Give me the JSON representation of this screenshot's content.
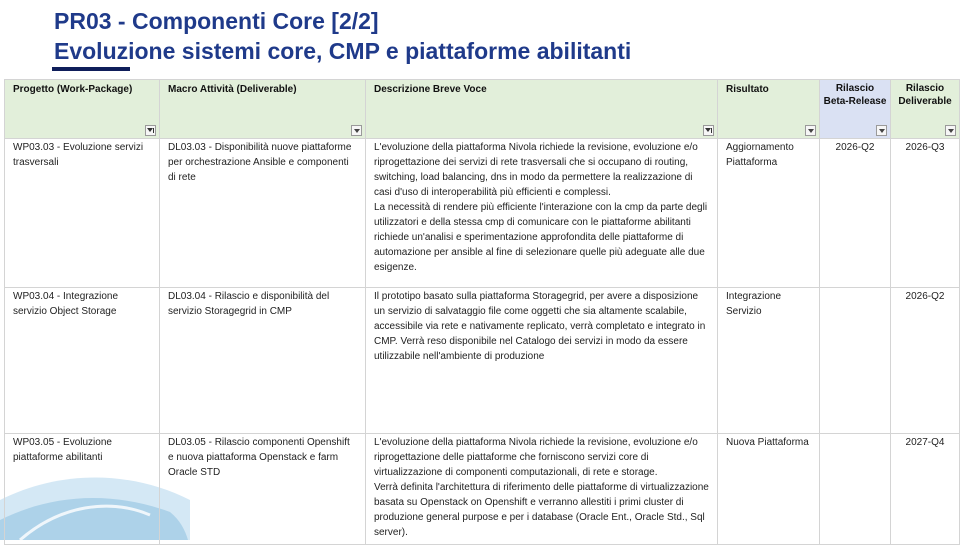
{
  "slide": {
    "title_line1": "PR03 - Componenti Core [2/2]",
    "title_line2": "Evoluzione sistemi core, CMP e piattaforme abilitanti"
  },
  "table": {
    "headers": [
      {
        "label": "Progetto (Work-Package)",
        "color": "#e2efda",
        "filter": "active"
      },
      {
        "label": "Macro Attività (Deliverable)",
        "color": "#e2efda",
        "filter": "dropdown"
      },
      {
        "label": "Descrizione Breve Voce",
        "color": "#e2efda",
        "filter": "active"
      },
      {
        "label": "Risultato",
        "color": "#e2efda",
        "filter": "dropdown"
      },
      {
        "label": "Rilascio Beta-Release",
        "color": "#dae1f3",
        "filter": "dropdown"
      },
      {
        "label": "Rilascio Deliverable",
        "color": "#dae1f3",
        "filter": "dropdown"
      }
    ],
    "rows": [
      {
        "progetto": "WP03.03 - Evoluzione servizi trasversali",
        "macro": "DL03.03 - Disponibilità nuove piattaforme per orchestrazione Ansible e componenti di rete",
        "descrizione_1": "L'evoluzione della piattaforma Nivola richiede la revisione, evoluzione e/o riprogettazione dei servizi di rete trasversali che si occupano di routing, switching, load balancing, dns in modo da permettere la realizzazione di casi d'uso di interoperabilità più efficienti e complessi.",
        "descrizione_2": "La necessità di rendere più efficiente l'interazione con la cmp da parte degli utilizzatori e della stessa cmp di comunicare con le piattaforme abilitanti richiede un'analisi e sperimentazione approfondita delle piattaforme di automazione per ansible al fine di selezionare quelle più adeguate alle due esigenze.",
        "risultato": "Aggiornamento Piattaforma",
        "beta": "2026-Q2",
        "deliverable": "2026-Q3"
      },
      {
        "progetto": "WP03.04 - Integrazione servizio Object Storage",
        "macro": "DL03.04 - Rilascio e disponibilità del servizio Storagegrid in CMP",
        "descrizione_1": "Il prototipo basato sulla piattaforma Storagegrid, per avere a disposizione un servizio di salvataggio file come oggetti che sia altamente scalabile, accessibile via rete e nativamente replicato, verrà completato e integrato in CMP. Verrà reso disponibile nel Catalogo dei servizi in modo da essere utilizzabile nell'ambiente di produzione",
        "descrizione_2": "",
        "risultato": "Integrazione Servizio",
        "beta": "",
        "deliverable": "2026-Q2"
      },
      {
        "progetto": "WP03.05 - Evoluzione piattaforme abilitanti",
        "macro": "DL03.05 - Rilascio componenti Openshift e nuova piattaforma Openstack e farm Oracle STD",
        "descrizione_1": "L'evoluzione della piattaforma Nivola richiede la revisione, evoluzione e/o riprogettazione delle piattaforme che forniscono servizi core di virtualizzazione di componenti computazionali, di rete e storage.",
        "descrizione_2": "Verrà definita l'architettura di riferimento delle piattaforme di virtualizzazione basata su Openstack on Openshift e verranno allestiti i primi cluster di produzione general purpose e per i database (Oracle Ent., Oracle Std., Sql server).",
        "risultato": "Nuova Piattaforma",
        "beta": "",
        "deliverable": "2027-Q4"
      }
    ]
  },
  "colors": {
    "title": "#1f3a8a",
    "header_green": "#e2efda",
    "header_blue": "#dae1f3",
    "decoration": "#a9cfe8"
  }
}
